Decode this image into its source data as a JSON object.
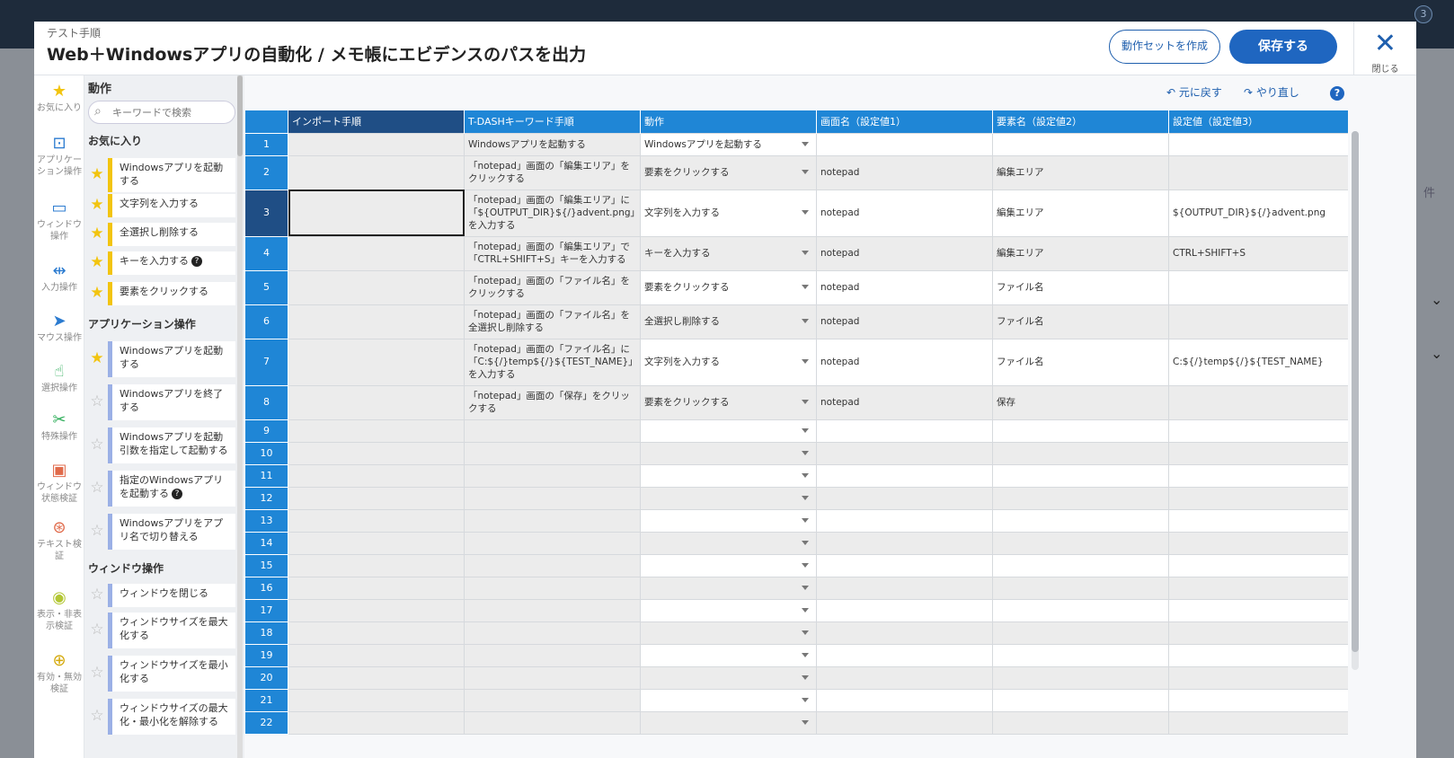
{
  "header": {
    "subtitle": "テスト手順",
    "title": "Web＋Windowsアプリの自動化 / メモ帳にエビデンスのパスを出力",
    "create_set_label": "動作セットを作成",
    "save_label": "保存する",
    "close_label": "閉じる",
    "close_icon": "✕"
  },
  "background": {
    "badge": "3",
    "right_label": "件"
  },
  "icon_sidebar": [
    {
      "icon": "★",
      "label": "お気に入り",
      "color": "#f2c40f"
    },
    {
      "icon": "⊡",
      "label": "アプリケーション操作"
    },
    {
      "icon": "▭",
      "label": "ウィンドウ操作"
    },
    {
      "icon": "⇹",
      "label": "入力操作"
    },
    {
      "icon": "➤",
      "label": "マウス操作"
    },
    {
      "icon": "☝",
      "label": "選択操作",
      "color": "#2fae5a"
    },
    {
      "icon": "✂",
      "label": "特殊操作",
      "color": "#2fae5a"
    },
    {
      "icon": "▣",
      "label": "ウィンドウ状態検証",
      "color": "#e06a4a"
    },
    {
      "icon": "⊛",
      "label": "テキスト検証",
      "color": "#e06a4a"
    },
    {
      "icon": "◉",
      "label": "表示・非表示検証",
      "color": "#b3c634"
    },
    {
      "icon": "⊕",
      "label": "有効・無効検証",
      "color": "#d4a90c"
    }
  ],
  "action_panel": {
    "title": "動作",
    "search_placeholder": "キーワードで検索",
    "sections": [
      {
        "title": "お気に入り",
        "items": [
          {
            "label": "Windowsアプリを起動する",
            "fav": true
          },
          {
            "label": "文字列を入力する",
            "fav": true
          },
          {
            "label": "全選択し削除する",
            "fav": true
          },
          {
            "label": "キーを入力する",
            "fav": true,
            "help": "?"
          },
          {
            "label": "要素をクリックする",
            "fav": true
          }
        ]
      },
      {
        "title": "アプリケーション操作",
        "items": [
          {
            "label": "Windowsアプリを起動する",
            "fav": true
          },
          {
            "label": "Windowsアプリを終了する",
            "fav": false
          },
          {
            "label": "Windowsアプリを起動 引数を指定して起動する",
            "fav": false
          },
          {
            "label": "指定のWindowsアプリを起動する",
            "fav": false,
            "help": "?"
          },
          {
            "label": "Windowsアプリをアプリ名で切り替える",
            "fav": false
          }
        ]
      },
      {
        "title": "ウィンドウ操作",
        "items": [
          {
            "label": "ウィンドウを閉じる",
            "fav": false
          },
          {
            "label": "ウィンドウサイズを最大化する",
            "fav": false
          },
          {
            "label": "ウィンドウサイズを最小化する",
            "fav": false
          },
          {
            "label": "ウィンドウサイズの最大化・最小化を解除する",
            "fav": false
          }
        ]
      }
    ]
  },
  "toolbar": {
    "undo_label": "元に戻す",
    "redo_label": "やり直し",
    "help": "?"
  },
  "grid": {
    "columns": [
      "インポート手順",
      "T-DASHキーワード手順",
      "動作",
      "画面名（設定値1）",
      "要素名（設定値2）",
      "設定値（設定値3）"
    ],
    "rows": [
      {
        "num": "1",
        "keyword": "Windowsアプリを起動する",
        "action": "Windowsアプリを起動する",
        "screen": "",
        "element": "",
        "value": ""
      },
      {
        "num": "2",
        "keyword": "「notepad」画面の「編集エリア」をクリックする",
        "action": "要素をクリックする",
        "screen": "notepad",
        "element": "編集エリア",
        "value": ""
      },
      {
        "num": "3",
        "keyword": "「notepad」画面の「編集エリア」に「${OUTPUT_DIR}${/}advent.png」を入力する",
        "action": "文字列を入力する",
        "screen": "notepad",
        "element": "編集エリア",
        "value": "${OUTPUT_DIR}${/}advent.png"
      },
      {
        "num": "4",
        "keyword": "「notepad」画面の「編集エリア」で「CTRL+SHIFT+S」キーを入力する",
        "action": "キーを入力する",
        "screen": "notepad",
        "element": "編集エリア",
        "value": "CTRL+SHIFT+S"
      },
      {
        "num": "5",
        "keyword": "「notepad」画面の「ファイル名」をクリックする",
        "action": "要素をクリックする",
        "screen": "notepad",
        "element": "ファイル名",
        "value": ""
      },
      {
        "num": "6",
        "keyword": "「notepad」画面の「ファイル名」を全選択し削除する",
        "action": "全選択し削除する",
        "screen": "notepad",
        "element": "ファイル名",
        "value": ""
      },
      {
        "num": "7",
        "keyword": "「notepad」画面の「ファイル名」に「C:${/}temp${/}${TEST_NAME}」を入力する",
        "action": "文字列を入力する",
        "screen": "notepad",
        "element": "ファイル名",
        "value": "C:${/}temp${/}${TEST_NAME}"
      },
      {
        "num": "8",
        "keyword": "「notepad」画面の「保存」をクリックする",
        "action": "要素をクリックする",
        "screen": "notepad",
        "element": "保存",
        "value": ""
      },
      {
        "num": "9",
        "keyword": "",
        "action": "",
        "screen": "",
        "element": "",
        "value": ""
      },
      {
        "num": "10",
        "keyword": "",
        "action": "",
        "screen": "",
        "element": "",
        "value": ""
      },
      {
        "num": "11",
        "keyword": "",
        "action": "",
        "screen": "",
        "element": "",
        "value": ""
      },
      {
        "num": "12",
        "keyword": "",
        "action": "",
        "screen": "",
        "element": "",
        "value": ""
      },
      {
        "num": "13",
        "keyword": "",
        "action": "",
        "screen": "",
        "element": "",
        "value": ""
      },
      {
        "num": "14",
        "keyword": "",
        "action": "",
        "screen": "",
        "element": "",
        "value": ""
      },
      {
        "num": "15",
        "keyword": "",
        "action": "",
        "screen": "",
        "element": "",
        "value": ""
      },
      {
        "num": "16",
        "keyword": "",
        "action": "",
        "screen": "",
        "element": "",
        "value": ""
      },
      {
        "num": "17",
        "keyword": "",
        "action": "",
        "screen": "",
        "element": "",
        "value": ""
      },
      {
        "num": "18",
        "keyword": "",
        "action": "",
        "screen": "",
        "element": "",
        "value": ""
      },
      {
        "num": "19",
        "keyword": "",
        "action": "",
        "screen": "",
        "element": "",
        "value": ""
      },
      {
        "num": "20",
        "keyword": "",
        "action": "",
        "screen": "",
        "element": "",
        "value": ""
      },
      {
        "num": "21",
        "keyword": "",
        "action": "",
        "screen": "",
        "element": "",
        "value": ""
      },
      {
        "num": "22",
        "keyword": "",
        "action": "",
        "screen": "",
        "element": "",
        "value": ""
      }
    ],
    "selected_row": "3"
  },
  "colors": {
    "primary": "#1f66c0",
    "header_blue": "#1f86d6",
    "header_dark": "#1f4e85",
    "favorite": "#f2c40f"
  }
}
